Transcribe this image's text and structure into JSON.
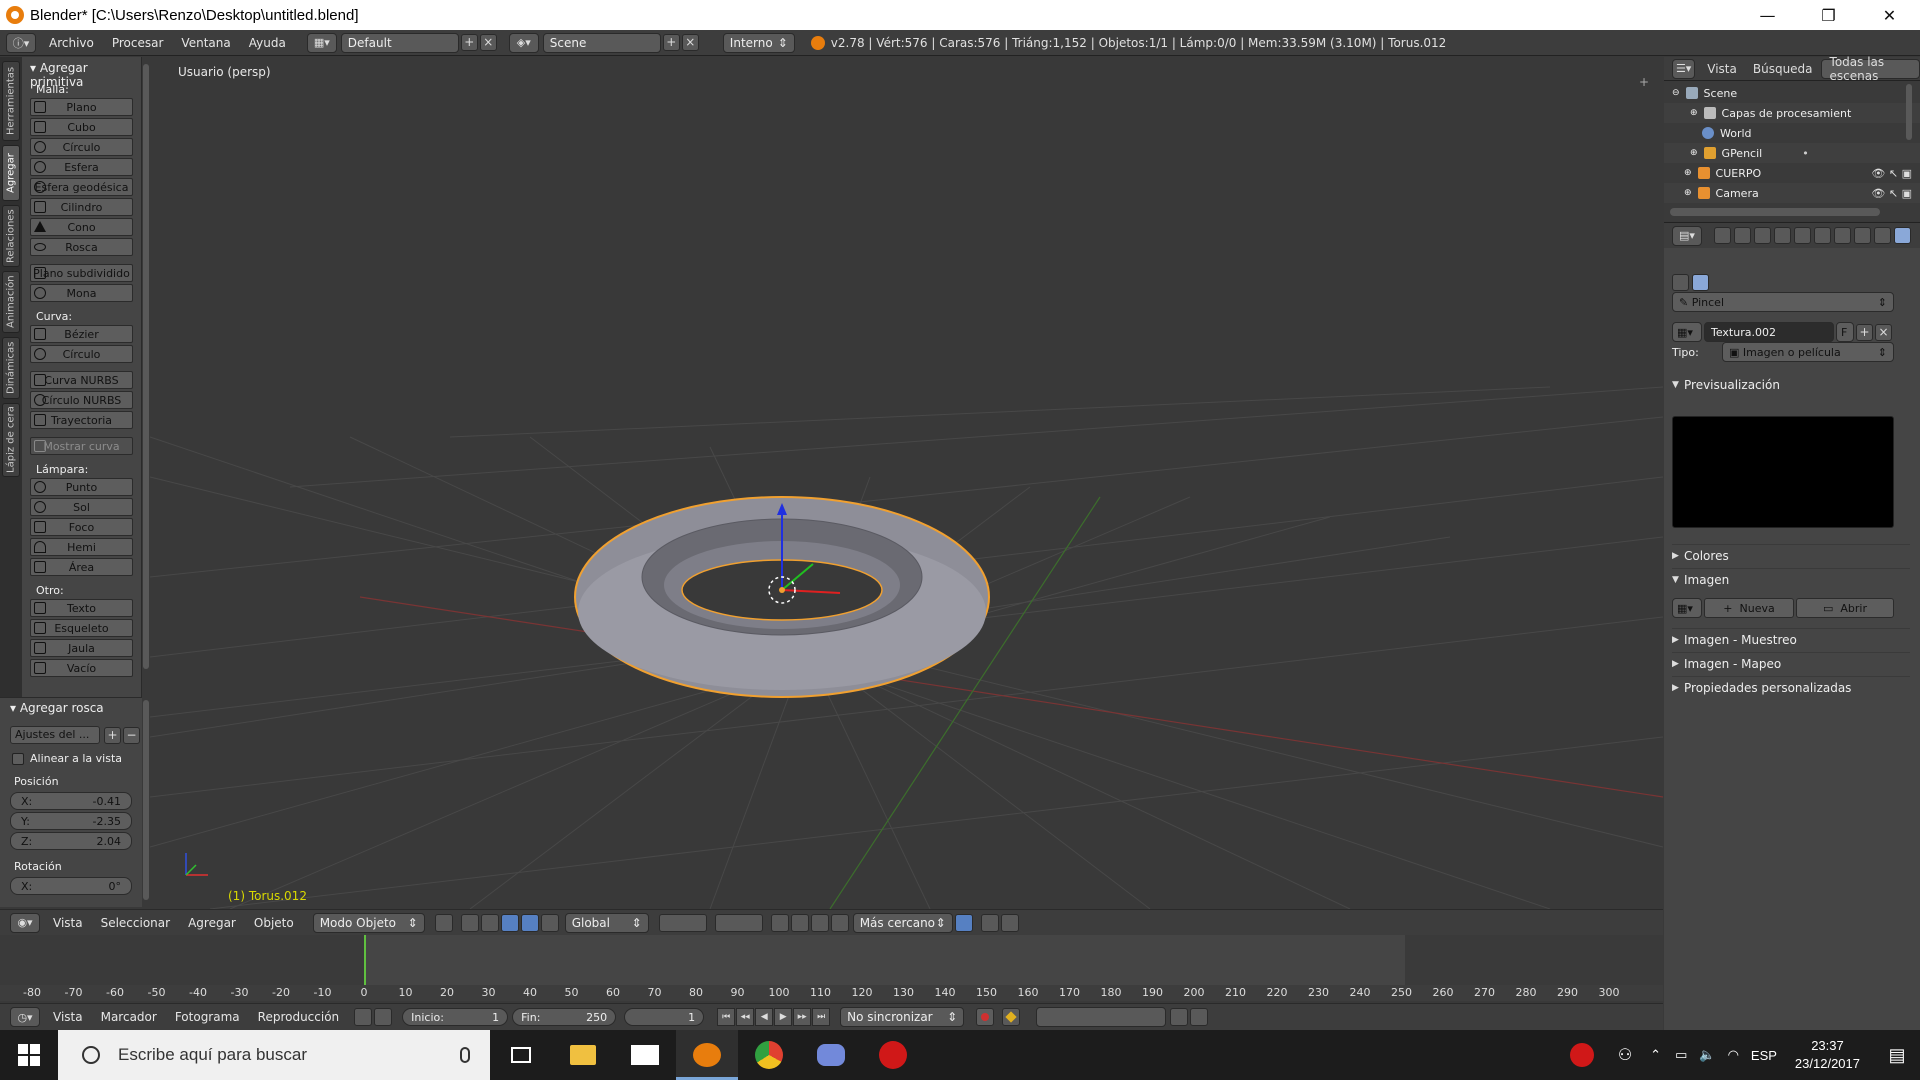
{
  "window": {
    "title": "Blender* [C:\\Users\\Renzo\\Desktop\\untitled.blend]",
    "controls": [
      "—",
      "❐",
      "✕"
    ]
  },
  "topbar": {
    "menus": [
      "Archivo",
      "Procesar",
      "Ventana",
      "Ayuda"
    ],
    "layout": "Default",
    "scene": "Scene",
    "engine": "Interno",
    "stats": "v2.78 | Vért:576 | Caras:576 | Triáng:1,152 | Objetos:1/1 | Lámp:0/0 | Mem:33.59M (3.10M) | Torus.012"
  },
  "left_tabs": [
    "Herramientas",
    "Agregar",
    "Relaciones",
    "Animación",
    "Dinámicas",
    "Lápiz de cera"
  ],
  "shelf": {
    "panel_title": "Agregar primitiva",
    "malla_label": "Malla:",
    "malla": [
      "Plano",
      "Cubo",
      "Círculo",
      "Esfera",
      "Esfera geodésica",
      "Cilindro",
      "Cono",
      "Rosca"
    ],
    "malla2": [
      "Plano subdividido",
      "Mona"
    ],
    "curva_label": "Curva:",
    "curva": [
      "Bézier",
      "Círculo"
    ],
    "curva2": [
      "Curva NURBS",
      "Círculo NURBS",
      "Trayectoria"
    ],
    "mostrar_curva": "Mostrar curva",
    "lampara_label": "Lámpara:",
    "lampara": [
      "Punto",
      "Sol",
      "Foco",
      "Hemi",
      "Área"
    ],
    "otro_label": "Otro:",
    "otro": [
      "Texto",
      "Esqueleto",
      "Jaula",
      "Vacío"
    ]
  },
  "operator": {
    "title": "Agregar rosca",
    "preset": "Ajustes del ...",
    "align": "Alinear a la vista",
    "posicion_label": "Posición",
    "pos": [
      {
        "axis": "X:",
        "value": "-0.41"
      },
      {
        "axis": "Y:",
        "value": "-2.35"
      },
      {
        "axis": "Z:",
        "value": "2.04"
      }
    ],
    "rotacion_label": "Rotación",
    "rot": [
      {
        "axis": "X:",
        "value": "0°"
      }
    ]
  },
  "viewport": {
    "view_label": "Usuario (persp)",
    "object_label": "(1) Torus.012",
    "colors": {
      "grid": "#4a4a4a",
      "x_axis": "#8a3030",
      "y_axis": "#3a7a2a",
      "selection": "#f0a030",
      "mesh": "#8e8e98"
    }
  },
  "viewport_header": {
    "menus": [
      "Vista",
      "Seleccionar",
      "Agregar",
      "Objeto"
    ],
    "mode": "Modo Objeto",
    "orientation": "Global",
    "snap": "Más cercano"
  },
  "timeline": {
    "ticks": [
      -80,
      -70,
      -60,
      -50,
      -40,
      -30,
      -20,
      -10,
      0,
      10,
      20,
      30,
      40,
      50,
      60,
      70,
      80,
      90,
      100,
      110,
      120,
      130,
      140,
      150,
      160,
      170,
      180,
      190,
      200,
      210,
      220,
      230,
      240,
      250,
      260,
      270,
      280,
      290,
      300
    ],
    "current_frame": 1,
    "menus": [
      "Vista",
      "Marcador",
      "Fotograma",
      "Reproducción"
    ],
    "start_label": "Inicio:",
    "start": "1",
    "end_label": "Fin:",
    "end": "250",
    "frame": "1",
    "sync": "No sincronizar"
  },
  "outliner": {
    "tabs": [
      "Vista",
      "Búsqueda",
      "Todas las escenas"
    ],
    "rows": [
      {
        "label": "Scene",
        "icon": "scene-icon",
        "color": "#9ab"
      },
      {
        "label": "Capas de procesamient",
        "icon": "render-layers-icon",
        "color": "#bbb"
      },
      {
        "label": "World",
        "icon": "world-icon",
        "color": "#6a8fc8"
      },
      {
        "label": "GPencil",
        "icon": "pencil-icon",
        "color": "#e0a030"
      },
      {
        "label": "CUERPO",
        "icon": "mesh-icon",
        "color": "#e89030"
      },
      {
        "label": "Camera",
        "icon": "camera-icon",
        "color": "#e89030"
      }
    ]
  },
  "properties": {
    "brush": "Pincel",
    "texture": "Textura.002",
    "fake_user": "F",
    "type_label": "Tipo:",
    "type": "Imagen o película",
    "preview": "Previsualización",
    "colors_panel": "Colores",
    "image_panel": "Imagen",
    "new_btn": "Nueva",
    "open_btn": "Abrir",
    "sampling": "Imagen - Muestreo",
    "mapping": "Imagen - Mapeo",
    "custom": "Propiedades personalizadas"
  },
  "taskbar": {
    "search_placeholder": "Escribe aquí para buscar",
    "lang": "ESP",
    "time": "23:37",
    "date": "23/12/2017"
  }
}
